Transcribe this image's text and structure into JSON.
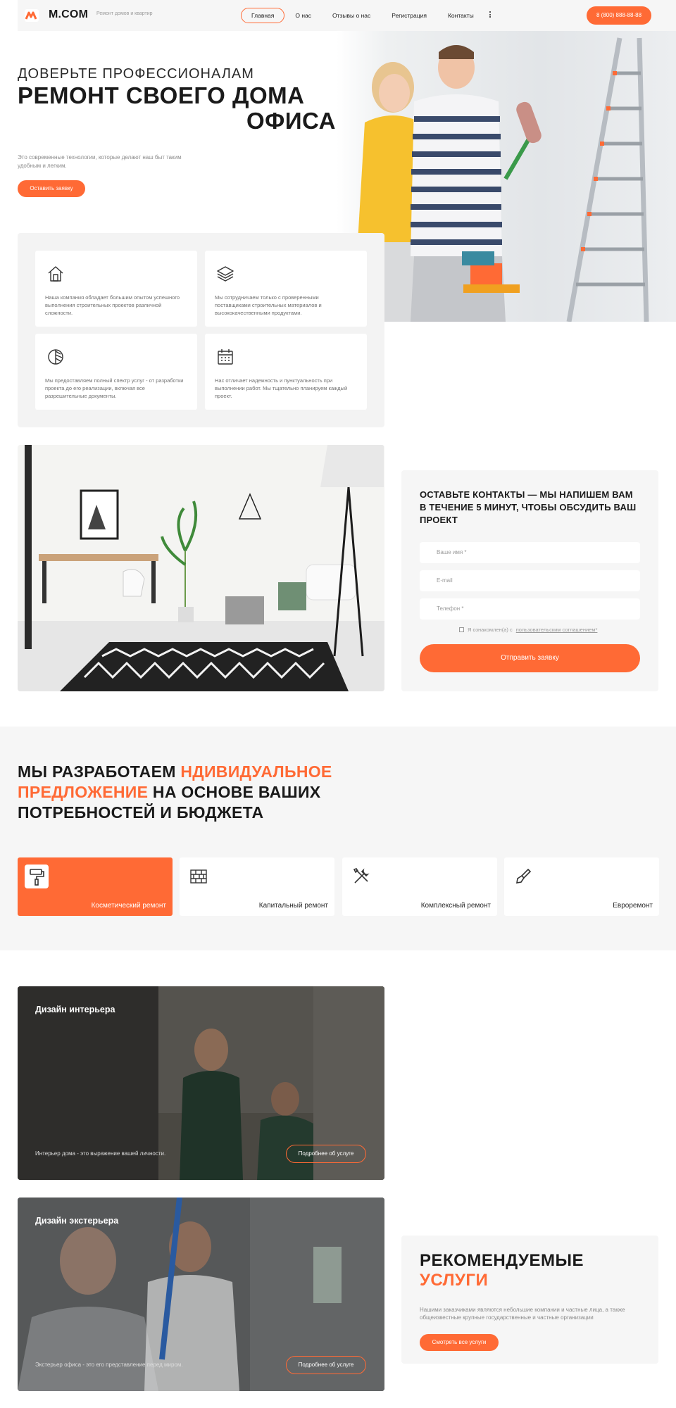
{
  "header": {
    "logo_text": "M.COM",
    "tagline": "Ремонт домов и квартир",
    "nav": [
      "Главная",
      "О нас",
      "Отзывы о нас",
      "Регистрация",
      "Контакты"
    ],
    "active_nav": "Главная",
    "phone": "8 (800) 888-88-88"
  },
  "hero": {
    "kicker": "ДОВЕРЬТЕ ПРОФЕССИОНАЛАМ",
    "title_line1": "РЕМОНТ СВОЕГО ДОМА",
    "title_line2": "ОФИСА",
    "description": "Это современные технологии, которые делают наш быт таким удобным и легким.",
    "cta": "Оставить заявку"
  },
  "features": [
    {
      "icon": "house-icon",
      "text": "Наша компания обладает большим опытом успешного выполнения строительных проектов различной сложности."
    },
    {
      "icon": "layers-icon",
      "text": "Мы сотрудничаем только с проверенными поставщиками строительных материалов и высококачественными продуктами."
    },
    {
      "icon": "compass-icon",
      "text": "Мы предоставляем полный спектр услуг - от разработки проекта до его реализации, включая все разрешительные документы."
    },
    {
      "icon": "calendar-icon",
      "text": "Нас отличает надежность и пунктуальность при выполнении работ. Мы тщательно планируем каждый проект."
    }
  ],
  "contact": {
    "title": "ОСТАВЬТЕ КОНТАКТЫ — МЫ НАПИШЕМ ВАМ В ТЕЧЕНИЕ 5 МИНУТ, ЧТОБЫ ОБСУДИТЬ ВАШ ПРОЕКТ",
    "name_placeholder": "Ваше имя *",
    "email_placeholder": "E-mail",
    "phone_placeholder": "Телефон *",
    "agree_prefix": "Я ознакомлен(а) с",
    "agree_link": "пользовательским соглашением*",
    "submit": "Отправить заявку"
  },
  "offer": {
    "title_part1": "МЫ РАЗРАБОТАЕМ ",
    "title_accent1": "НДИВИДУАЛЬНОЕ",
    "title_accent2": "ПРЕДЛОЖЕНИЕ",
    "title_part2": " НА ОСНОВЕ ВАШИХ",
    "title_part3": "ПОТРЕБНОСТЕЙ И БЮДЖЕТА",
    "services": [
      {
        "label": "Косметический ремонт",
        "icon": "paint-roller-icon",
        "active": true
      },
      {
        "label": "Капитальный ремонт",
        "icon": "brick-wall-icon",
        "active": false
      },
      {
        "label": "Комплексный ремонт",
        "icon": "tools-icon",
        "active": false
      },
      {
        "label": "Евроремонт",
        "icon": "paint-brush-icon",
        "active": false
      }
    ]
  },
  "designs": [
    {
      "title": "Дизайн интерьера",
      "desc": "Интерьер дома - это выражение вашей личности.",
      "button": "Подробнее об услуге"
    },
    {
      "title": "Дизайн экстерьера",
      "desc": "Экстерьер офиса - это его представление перед миром.",
      "button": "Подробнее об услуге"
    }
  ],
  "recommended": {
    "title_line1": "РЕКОМЕНДУЕМЫЕ",
    "title_line2": "УСЛУГИ",
    "description": "Нашими заказчиками являются небольшие компании и частные лица, а также общеизвестные крупные государственные и частные организации",
    "button": "Смотреть все услуги"
  },
  "colors": {
    "accent": "#ff6a35",
    "panel": "#f6f6f6",
    "text": "#1a1a1a"
  }
}
